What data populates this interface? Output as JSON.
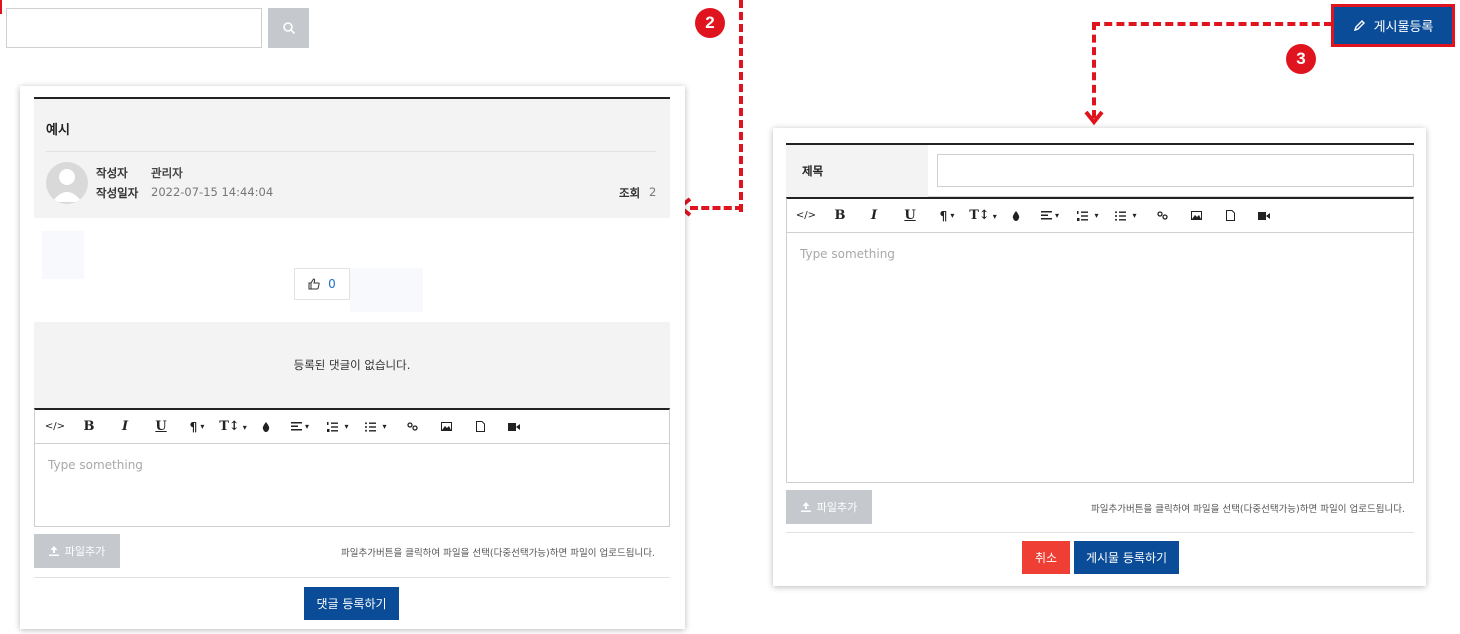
{
  "search": {
    "placeholder": "",
    "button_icon": "search-icon"
  },
  "badges": {
    "two": "2",
    "three": "3"
  },
  "post_button": {
    "label": "게시물등록",
    "icon": "pencil-icon"
  },
  "view": {
    "title": "예시",
    "author_label": "작성자",
    "author_value": "관리자",
    "date_label": "작성일자",
    "date_value": "2022-07-15 14:44:04",
    "views_label": "조회",
    "views_value": "2",
    "like_count": "0",
    "no_comments": "등록된 댓글이 없습니다.",
    "editor_placeholder": "Type something",
    "file_add_label": "파일추가",
    "file_hint": "파일추가버튼을 클릭하여 파일을 선택(다중선택가능)하면 파일이 업로드됩니다.",
    "submit_comment": "댓글 등록하기"
  },
  "write": {
    "title_label": "제목",
    "title_value": "",
    "editor_placeholder": "Type something",
    "file_add_label": "파일추가",
    "file_hint": "파일추가버튼을 클릭하여 파일을 선택(다중선택가능)하면 파일이 업로드됩니다.",
    "cancel": "취소",
    "submit": "게시물 등록하기"
  },
  "toolbar": {
    "code": "</>",
    "bold": "B",
    "italic": "I",
    "underline": "U",
    "paragraph": "¶",
    "textsize": "T↕",
    "caret": "▾"
  },
  "colors": {
    "accent_red": "#e0141e",
    "brand_blue": "#0a4c97",
    "cancel_red": "#ef3f34",
    "gray_button": "#c5c8cd"
  }
}
